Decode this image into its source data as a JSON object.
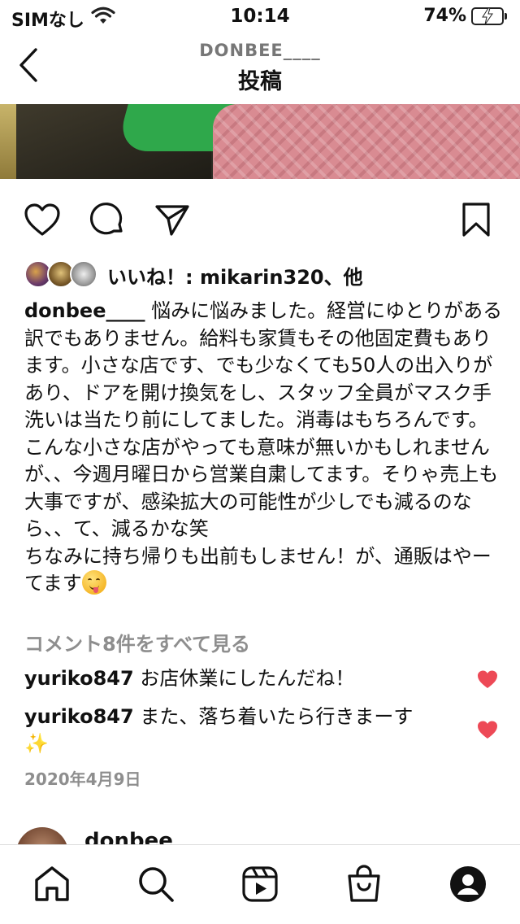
{
  "status_bar": {
    "carrier": "SIMなし",
    "time": "10:14",
    "battery_percent": "74%",
    "battery_level": 0.74
  },
  "header": {
    "username": "DONBEE____",
    "title": "投稿"
  },
  "likes": {
    "text": "いいね！: mikarin320、他"
  },
  "caption": {
    "username": "donbee____",
    "text_1": "悩みに悩みました。経営にゆとりがある訳でもありません。給料も家賃もその他固定費もあります。小さな店です、でも少なくても50人の出入りがあり、ドアを開け換気をし、スタッフ全員がマスク手洗いは当たり前にしてました。消毒はもちろんです。こんな小さな店がやっても意味が無いかもしれませんが、、今週月曜日から営業自粛してます。そりゃ売上も大事ですが、感染拡大の可能性が少しでも減るのなら、、て、減るかな笑",
    "text_2": "ちなみに持ち帰りも出前もしません！が、通販はやーてます"
  },
  "comments": {
    "view_all": "コメント8件をすべて見る",
    "items": [
      {
        "user": "yuriko847",
        "text": "お店休業にしたんだね！"
      },
      {
        "user": "yuriko847",
        "text": "また、落ち着いたら行きまーす",
        "emoji": "✨"
      }
    ]
  },
  "date": "2020年4月9日",
  "next_post": {
    "username": "donbee"
  },
  "colors": {
    "like_red": "#ed4956",
    "muted_gray": "#8e8e8e",
    "battery_green": "#34c759"
  },
  "icons": {
    "status": [
      "wifi-icon",
      "battery-icon"
    ],
    "header": [
      "back-chevron-icon"
    ],
    "actions": [
      "heart-icon",
      "comment-icon",
      "share-icon",
      "bookmark-icon"
    ],
    "tabs": [
      "home-icon",
      "search-icon",
      "reels-icon",
      "shop-icon",
      "profile-icon"
    ]
  }
}
